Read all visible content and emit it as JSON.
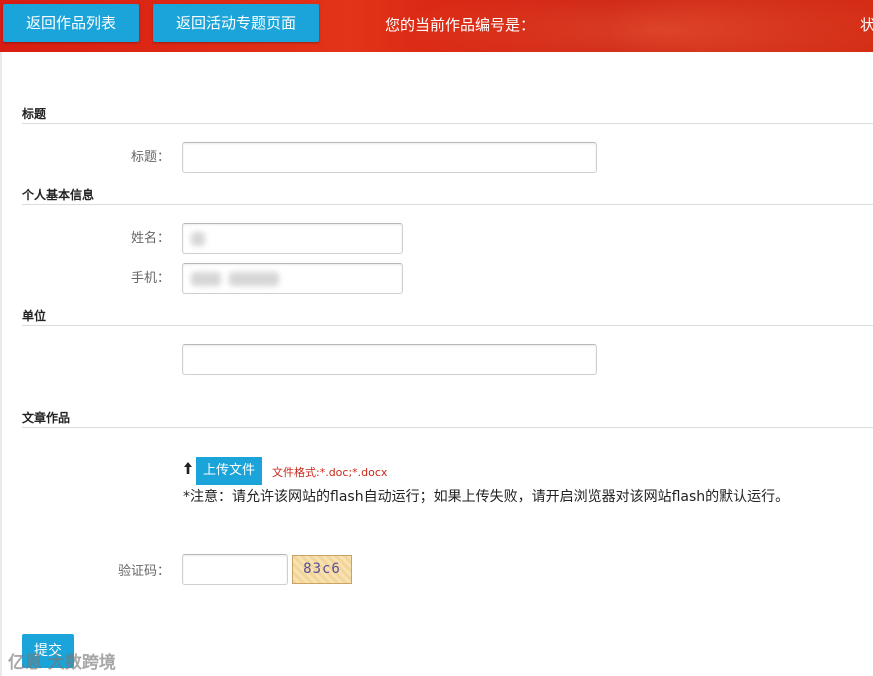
{
  "header": {
    "back_to_list": "返回作品列表",
    "back_to_topic": "返回活动专题页面",
    "work_number_label": "您的当前作品编号是：",
    "status_fragment": "状"
  },
  "sections": {
    "title": "标题",
    "personal_info": "个人基本信息",
    "organization": "单位",
    "article": "文章作品"
  },
  "fields": {
    "title_label": "标题：",
    "title_value": "",
    "name_label": "姓名：",
    "phone_label": "手机：",
    "organization_value": "",
    "captcha_label": "验证码：",
    "captcha_value": ""
  },
  "upload": {
    "button_label": "上传文件",
    "format_hint": "文件格式:*.doc;*.docx",
    "note": "*注意：请允许该网站的flash自动运行；如果上传失败，请开启浏览器对该网站flash的默认运行。"
  },
  "captcha_image_text": "83c6",
  "submit_label": "提交",
  "watermark": "亿恩 大数跨境"
}
